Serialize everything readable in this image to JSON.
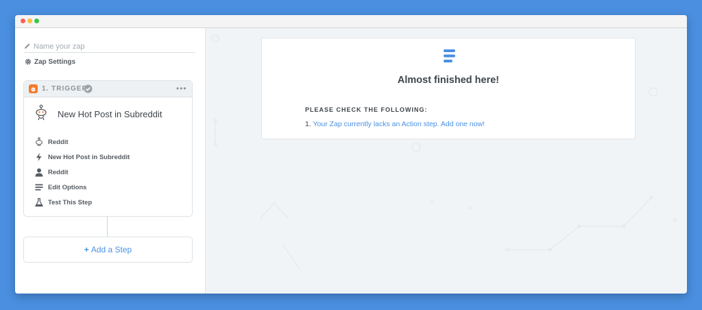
{
  "window": {
    "controls": [
      "close",
      "minimize",
      "maximize"
    ]
  },
  "sidebar": {
    "name_placeholder": "Name your zap",
    "name_icon": "pencil-icon",
    "settings_label": "Zap Settings",
    "settings_icon": "gear-icon",
    "trigger": {
      "label": "1. TRIGGER",
      "status_icon": "check-circle-icon",
      "app_badge_color": "#f47a2c",
      "title": "New Hot Post in Subreddit",
      "title_icon": "reddit-icon",
      "more_label": "•••",
      "items": [
        {
          "icon": "reddit-icon",
          "label": "Reddit"
        },
        {
          "icon": "bolt-icon",
          "label": "New Hot Post in Subreddit"
        },
        {
          "icon": "user-icon",
          "label": "Reddit"
        },
        {
          "icon": "lines-icon",
          "label": "Edit Options"
        },
        {
          "icon": "flask-icon",
          "label": "Test This Step"
        }
      ]
    },
    "add_step": {
      "plus": "+",
      "label": "Add a Step"
    }
  },
  "main": {
    "panel": {
      "icon": "zapier-lines-icon",
      "title": "Almost finished here!",
      "check_heading": "PLEASE CHECK THE FOLLOWING:",
      "issues": [
        {
          "number": "1.",
          "text": "Your Zap currently lacks an Action step. Add one now!"
        }
      ]
    }
  },
  "colors": {
    "accent": "#4a90e2",
    "background": "#4a8fe0",
    "canvas": "#f1f4f6"
  }
}
